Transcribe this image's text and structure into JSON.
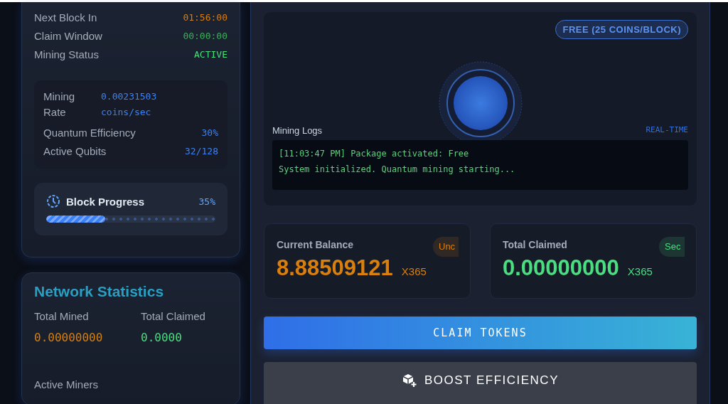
{
  "status_card": {
    "rows": [
      {
        "label": "Next Block In",
        "value": "01:56:00",
        "color": "#d97f0e"
      },
      {
        "label": "Claim Window",
        "value": "00:00:00",
        "color": "#3fae5a"
      },
      {
        "label": "Mining Status",
        "value": "ACTIVE",
        "color": "#4ade80"
      }
    ],
    "stats": [
      {
        "label": "Mining Rate",
        "value": "0.00231503 coins/sec",
        "kind": "wrap"
      },
      {
        "label": "Quantum Efficiency",
        "value": "30%",
        "kind": "inline"
      },
      {
        "label": "Active Qubits",
        "value": "32/128",
        "kind": "inline"
      }
    ],
    "progress": {
      "title": "Block Progress",
      "percent": "35%",
      "level": 0.35
    }
  },
  "network": {
    "title": "Network Statistics",
    "items": [
      {
        "label": "Total Mined",
        "value": "0.00000000",
        "color": "#d97f0e"
      },
      {
        "label": "Total Claimed",
        "value": "0.0000",
        "color": "#4ade80"
      }
    ],
    "footer_label": "Active Miners"
  },
  "miner": {
    "package_badge": "FREE (25 COINS/BLOCK)",
    "logs_title": "Mining Logs",
    "logs_tag": "REAL-TIME",
    "logs": [
      "[11:03:47 PM] Package activated: Free",
      "System initialized. Quantum mining starting..."
    ]
  },
  "balances": [
    {
      "title": "Current Balance",
      "amount": "8.88509121",
      "unit": "X365",
      "badge": "Unc",
      "color": "#d97f0e"
    },
    {
      "title": "Total Claimed",
      "amount": "0.00000000",
      "unit": "X365",
      "badge": "Sec",
      "color": "#4ade80"
    }
  ],
  "buttons": {
    "claim": "CLAIM TOKENS",
    "boost": "BOOST EFFICIENCY"
  }
}
